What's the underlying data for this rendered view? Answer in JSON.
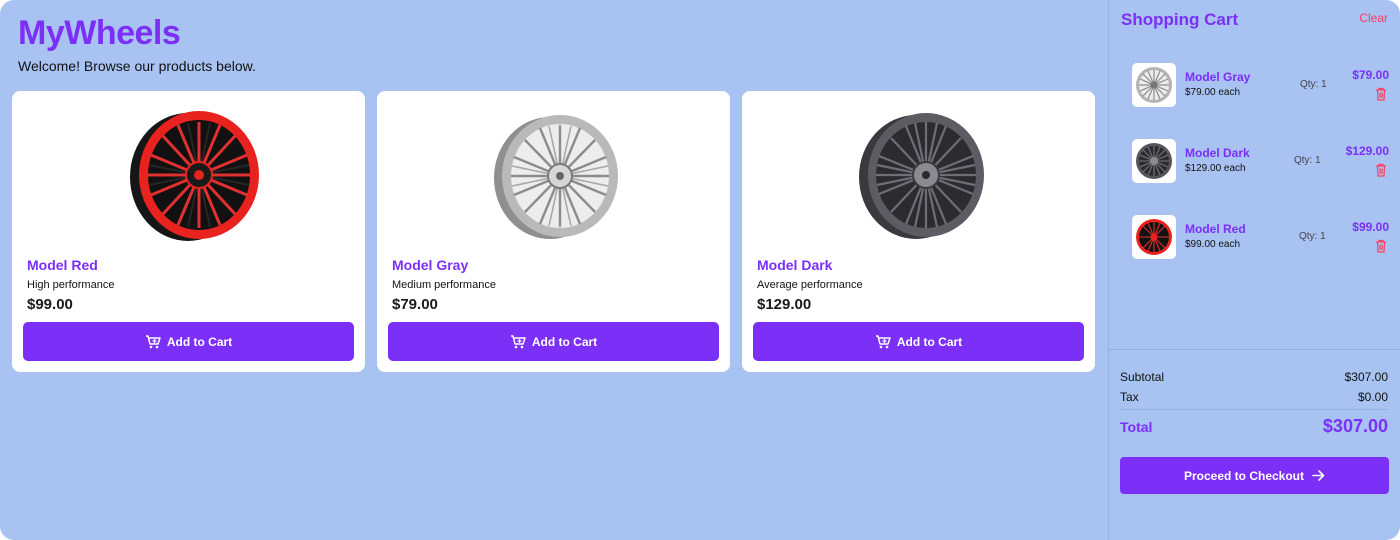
{
  "app": {
    "brand": "MyWheels",
    "welcome": "Welcome! Browse our products below."
  },
  "colors": {
    "accent": "#7b2ff7",
    "background": "#a8c2f2",
    "danger": "#ff3b5c"
  },
  "products": [
    {
      "name": "Model Red",
      "description": "High performance",
      "price": "$99.00",
      "button": "Add to Cart",
      "image": "red-wheel-icon"
    },
    {
      "name": "Model Gray",
      "description": "Medium performance",
      "price": "$79.00",
      "button": "Add to Cart",
      "image": "gray-wheel-icon"
    },
    {
      "name": "Model Dark",
      "description": "Average performance",
      "price": "$129.00",
      "button": "Add to Cart",
      "image": "dark-wheel-icon"
    }
  ],
  "cart": {
    "title": "Shopping Cart",
    "clear_label": "Clear",
    "items": [
      {
        "name": "Model Gray",
        "each": "$79.00 each",
        "qty": "Qty: 1",
        "total": "$79.00",
        "image": "gray-wheel-icon"
      },
      {
        "name": "Model Dark",
        "each": "$129.00 each",
        "qty": "Qty: 1",
        "total": "$129.00",
        "image": "dark-wheel-icon"
      },
      {
        "name": "Model Red",
        "each": "$99.00 each",
        "qty": "Qty: 1",
        "total": "$99.00",
        "image": "red-wheel-icon"
      }
    ],
    "subtotal_label": "Subtotal",
    "subtotal": "$307.00",
    "tax_label": "Tax",
    "tax": "$0.00",
    "total_label": "Total",
    "total": "$307.00",
    "checkout_label": "Proceed to Checkout"
  }
}
